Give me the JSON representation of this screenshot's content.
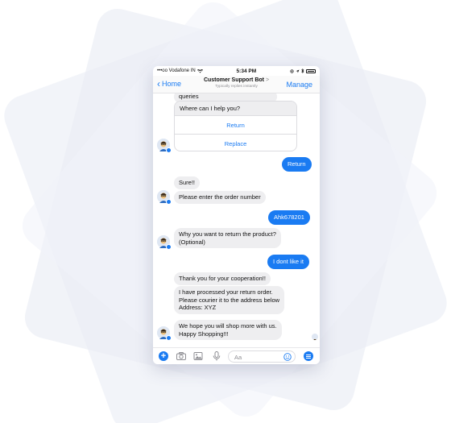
{
  "status_bar": {
    "carrier": "•••oo Vodafone IN",
    "time": "5:34 PM"
  },
  "nav": {
    "back_label": "Home",
    "title": "Customer Support Bot",
    "title_arrow": ">",
    "subtitle": "Typically replies instantly",
    "manage_label": "Manage"
  },
  "chat": {
    "partial_message": "queries",
    "card": {
      "question": "Where can I help you?",
      "options": [
        "Return",
        "Replace"
      ]
    },
    "reply_return": "Return",
    "bot_sure": "Sure!!",
    "bot_order_prompt": "Please enter the order number",
    "user_order_number": "Ahk678201",
    "bot_reason_line1": "Why you want to return the product?",
    "bot_reason_line2": "(Optional)",
    "user_reason": "I dont like it",
    "bot_thanks": "Thank you for your cooperation!!",
    "bot_processed_line1": "I have processed your return order.",
    "bot_processed_line2": "Please courier it to the address below",
    "bot_processed_line3": "Address: XYZ",
    "bot_final_line1": "We hope you will shop more with us.",
    "bot_final_line2": "Happy Shopping!!!"
  },
  "composer": {
    "placeholder": "Aa",
    "icons": [
      "plus-icon",
      "camera-icon",
      "image-icon",
      "microphone-icon",
      "emoji-icon",
      "menu-icon"
    ]
  },
  "colors": {
    "accent": "#1a7bf2",
    "incoming_bubble": "#eeeef0",
    "background_shapes": "#eef0f7"
  }
}
